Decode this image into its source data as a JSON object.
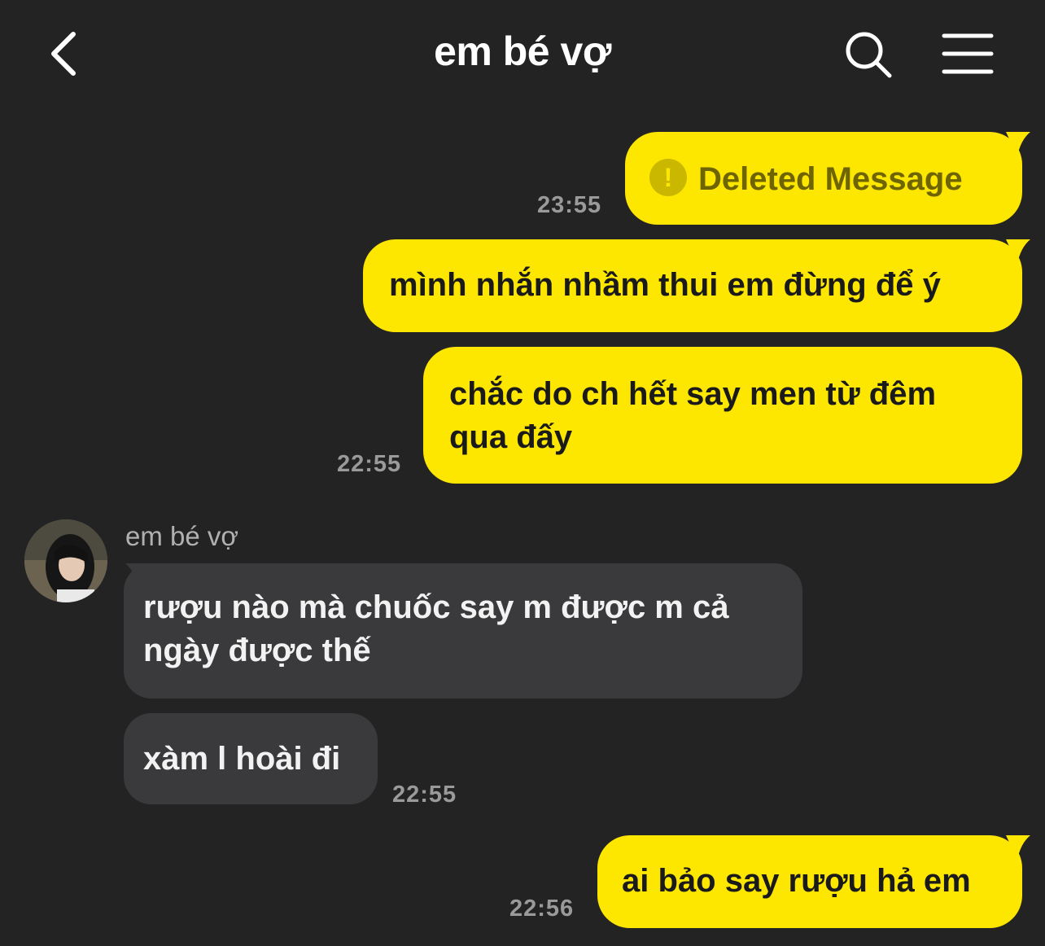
{
  "header": {
    "title": "em bé vợ",
    "back_icon": "chevron-left-icon",
    "search_icon": "search-icon",
    "menu_icon": "hamburger-menu-icon"
  },
  "colors": {
    "background": "#232324",
    "my_bubble": "#fde600",
    "their_bubble": "#3a3a3c"
  },
  "messages": [
    {
      "sender": "me",
      "text": "Deleted Message",
      "deleted": true,
      "time": "23:55"
    },
    {
      "sender": "me",
      "text": "mình nhắn nhầm thui em đừng để ý",
      "time": ""
    },
    {
      "sender": "me",
      "text": "chắc do ch hết say men từ đêm qua đấy",
      "time": "22:55"
    },
    {
      "sender": "them",
      "name": "em bé vợ",
      "text": "rượu nào mà chuốc say m được m cả ngày được thế",
      "time": ""
    },
    {
      "sender": "them",
      "text": "xàm l hoài đi",
      "time": "22:55"
    },
    {
      "sender": "me",
      "text": "ai bảo say rượu hả em",
      "time": "22:56"
    }
  ]
}
